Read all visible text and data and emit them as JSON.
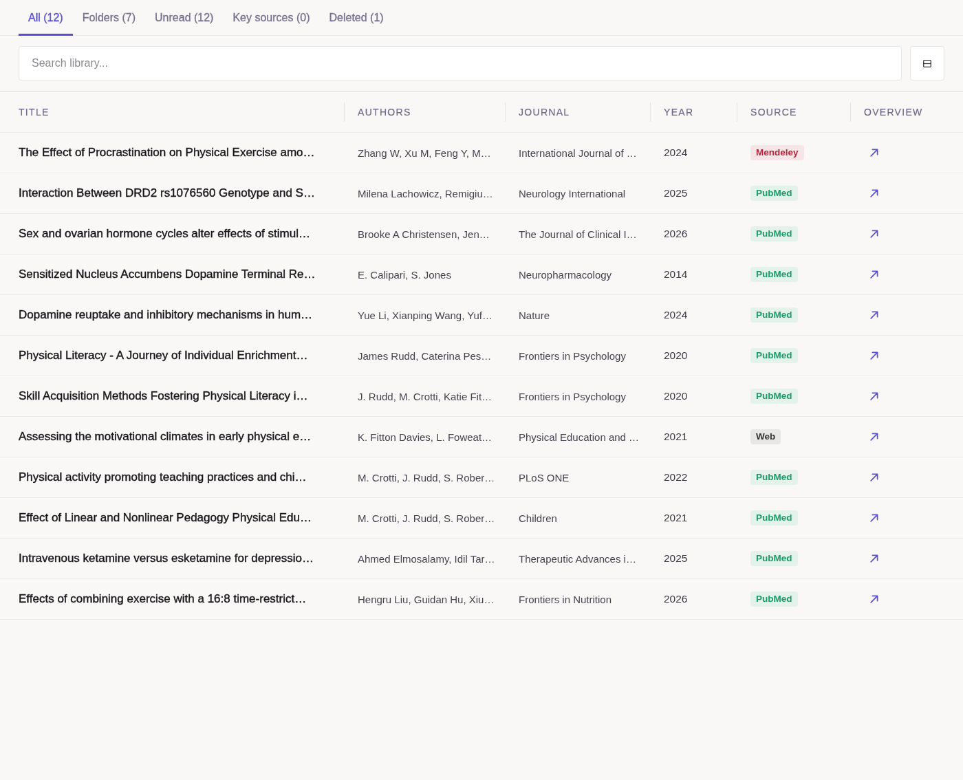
{
  "tabs": [
    {
      "label": "All (12)",
      "selected": true
    },
    {
      "label": "Folders (7)",
      "selected": false
    },
    {
      "label": "Unread (12)",
      "selected": false
    },
    {
      "label": "Key sources (0)",
      "selected": false
    },
    {
      "label": "Deleted (1)",
      "selected": false
    }
  ],
  "search": {
    "placeholder": "Search library..."
  },
  "table": {
    "columns": [
      "TITLE",
      "AUTHORS",
      "JOURNAL",
      "YEAR",
      "SOURCE",
      "OVERVIEW"
    ],
    "rows": [
      {
        "title": "The Effect of Procrastination on Physical Exercise amo…",
        "authors": "Zhang W, Xu M, Feng Y, M…",
        "journal": "International Journal of …",
        "year": "2024",
        "source": {
          "label": "Mendeley",
          "color": "#b3263b"
        }
      },
      {
        "title": "Interaction Between DRD2 rs1076560 Genotype and S…",
        "authors": "Milena Lachowicz, Remigiu…",
        "journal": "Neurology International",
        "year": "2025",
        "source": {
          "label": "PubMed",
          "color": "#1c9a68"
        }
      },
      {
        "title": "Sex and ovarian hormone cycles alter effects of stimul…",
        "authors": "Brooke A Christensen, Jen…",
        "journal": "The Journal of Clinical I…",
        "year": "2026",
        "source": {
          "label": "PubMed",
          "color": "#1c9a68"
        }
      },
      {
        "title": "Sensitized Nucleus Accumbens Dopamine Terminal Re…",
        "authors": "E. Calipari, S. Jones",
        "journal": "Neuropharmacology",
        "year": "2014",
        "source": {
          "label": "PubMed",
          "color": "#1c9a68"
        }
      },
      {
        "title": "Dopamine reuptake and inhibitory mechanisms in hum…",
        "authors": "Yue Li, Xianping Wang, Yuf…",
        "journal": "Nature",
        "year": "2024",
        "source": {
          "label": "PubMed",
          "color": "#1c9a68"
        }
      },
      {
        "title": "Physical Literacy - A Journey of Individual Enrichment…",
        "authors": "James Rudd, Caterina Pes…",
        "journal": "Frontiers in Psychology",
        "year": "2020",
        "source": {
          "label": "PubMed",
          "color": "#1c9a68"
        }
      },
      {
        "title": "Skill Acquisition Methods Fostering Physical Literacy i…",
        "authors": "J. Rudd, M. Crotti, Katie Fit…",
        "journal": "Frontiers in Psychology",
        "year": "2020",
        "source": {
          "label": "PubMed",
          "color": "#1c9a68"
        }
      },
      {
        "title": "Assessing the motivational climates in early physical e…",
        "authors": "K. Fitton Davies, L. Foweat…",
        "journal": "Physical Education and …",
        "year": "2021",
        "source": {
          "label": "Web",
          "color": "#333333"
        }
      },
      {
        "title": "Physical activity promoting teaching practices and chi…",
        "authors": "M. Crotti, J. Rudd, S. Rober…",
        "journal": "PLoS ONE",
        "year": "2022",
        "source": {
          "label": "PubMed",
          "color": "#1c9a68"
        }
      },
      {
        "title": "Effect of Linear and Nonlinear Pedagogy Physical Edu…",
        "authors": "M. Crotti, J. Rudd, S. Rober…",
        "journal": "Children",
        "year": "2021",
        "source": {
          "label": "PubMed",
          "color": "#1c9a68"
        }
      },
      {
        "title": "Intravenous ketamine versus esketamine for depressio…",
        "authors": "Ahmed Elmosalamy, Idil Tar…",
        "journal": "Therapeutic Advances i…",
        "year": "2025",
        "source": {
          "label": "PubMed",
          "color": "#1c9a68"
        }
      },
      {
        "title": "Effects of combining exercise with a 16:8 time-restrict…",
        "authors": "Hengru Liu, Guidan Hu, Xiu…",
        "journal": "Frontiers in Nutrition",
        "year": "2026",
        "source": {
          "label": "PubMed",
          "color": "#1c9a68"
        }
      }
    ]
  }
}
